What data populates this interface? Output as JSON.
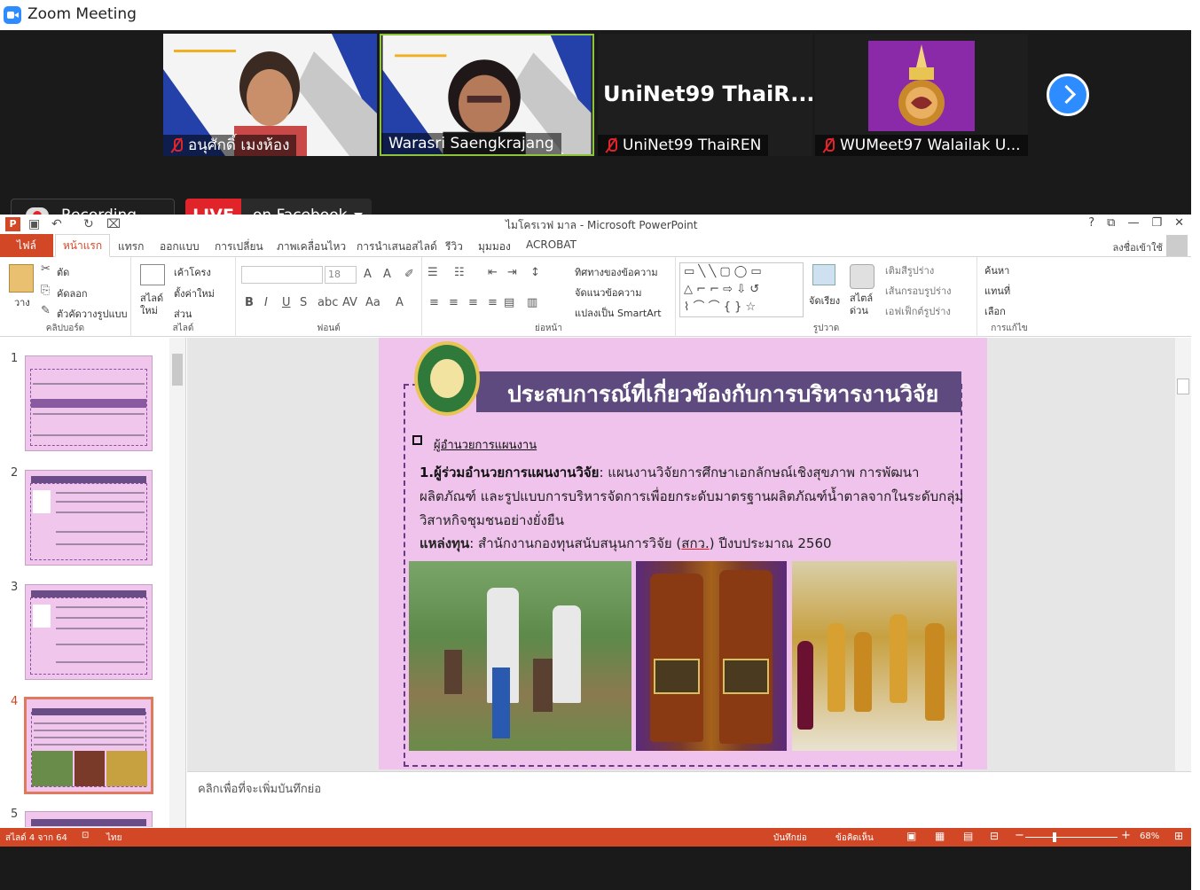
{
  "window": {
    "title": "Zoom Meeting"
  },
  "participants": [
    {
      "name": "อนุศักดิ์ เมงห้อง",
      "muted": true
    },
    {
      "name": "Warasri Saengkrajang",
      "muted": false,
      "active": true
    },
    {
      "name": "UniNet99 ThaiREN",
      "muted": true,
      "display_text": "UniNet99  ThaiR..."
    },
    {
      "name": "WUMeet97 Walailak U...",
      "muted": true
    }
  ],
  "recording": {
    "label": "Recording..."
  },
  "live": {
    "badge": "LIVE",
    "label": "on Facebook"
  },
  "ppt": {
    "title": "ไมโครเวฟ มาล - Microsoft PowerPoint",
    "icon": "P",
    "window_controls": [
      "?",
      "⧉",
      "—",
      "❐",
      "✕"
    ],
    "tabs": [
      "ไฟล์",
      "หน้าแรก",
      "แทรก",
      "ออกแบบ",
      "การเปลี่ยน",
      "ภาพเคลื่อนไหว",
      "การนำเสนอสไลด์",
      "รีวิว",
      "มุมมอง",
      "ACROBAT"
    ],
    "signin": "ลงชื่อเข้าใช้",
    "ribbon": {
      "clipboard": {
        "label": "คลิปบอร์ด",
        "paste": "วาง",
        "cut": "ตัด",
        "copy": "คัดลอก",
        "format_painter": "ตัวคัดวางรูปแบบ"
      },
      "slides": {
        "label": "สไลด์",
        "new_slide": "สไลด์ ใหม่",
        "layout": "เค้าโครง",
        "reset": "ตั้งค่าใหม่",
        "section": "ส่วน"
      },
      "font": {
        "label": "ฟอนต์",
        "size": "18"
      },
      "paragraph": {
        "label": "ย่อหน้า",
        "direction": "ทิศทางของข้อความ",
        "align": "จัดแนวข้อความ",
        "smartart": "แปลงเป็น SmartArt"
      },
      "drawing": {
        "label": "รูปวาด",
        "arrange": "จัดเรียง",
        "quick_styles": "สไตล์ ด่วน",
        "fill": "เติมสีรูปร่าง",
        "outline": "เส้นกรอบรูปร่าง",
        "effects": "เอฟเฟ็กต์รูปร่าง"
      },
      "editing": {
        "label": "การแก้ไข",
        "find": "ค้นหา",
        "replace": "แทนที่",
        "select": "เลือก"
      }
    },
    "thumb_numbers": [
      "1",
      "2",
      "3",
      "4",
      "5"
    ],
    "selected_slide": 4,
    "slide": {
      "title": "ประสบการณ์ที่เกี่ยวข้องกับการบริหารงานวิจัย",
      "bullet": "ผู้อำนวยการแผนงาน",
      "p1_bold": "1.ผู้ร่วมอำนวยการแผนงานวิจัย",
      "p1_text": ": แผนงานวิจัยการศึกษาเอกลักษณ์เชิงสุขภาพ การพัฒนาผลิตภัณฑ์ และรูปแบบการบริหารจัดการเพื่อยกระดับมาตรฐานผลิตภัณฑ์น้ำตาลจากในระดับกลุ่มวิสาหกิจชุมชนอย่างยั่งยืน",
      "fund_bold": "แหล่งทุน",
      "fund_text": ": สำนักงานกองทุนสนับสนุนการวิจัย (",
      "fund_abbr": "สกว.",
      "fund_year": ")  ปีงบประมาณ 2560"
    },
    "notes_placeholder": "คลิกเพื่อที่จะเพิ่มบันทึกย่อ",
    "status": {
      "slide_count": "สไลด์ 4 จาก 64",
      "language": "ไทย",
      "notes": "บันทึกย่อ",
      "comments": "ข้อคิดเห็น",
      "zoom": "68%",
      "zoom_fraction": 0.68
    }
  }
}
